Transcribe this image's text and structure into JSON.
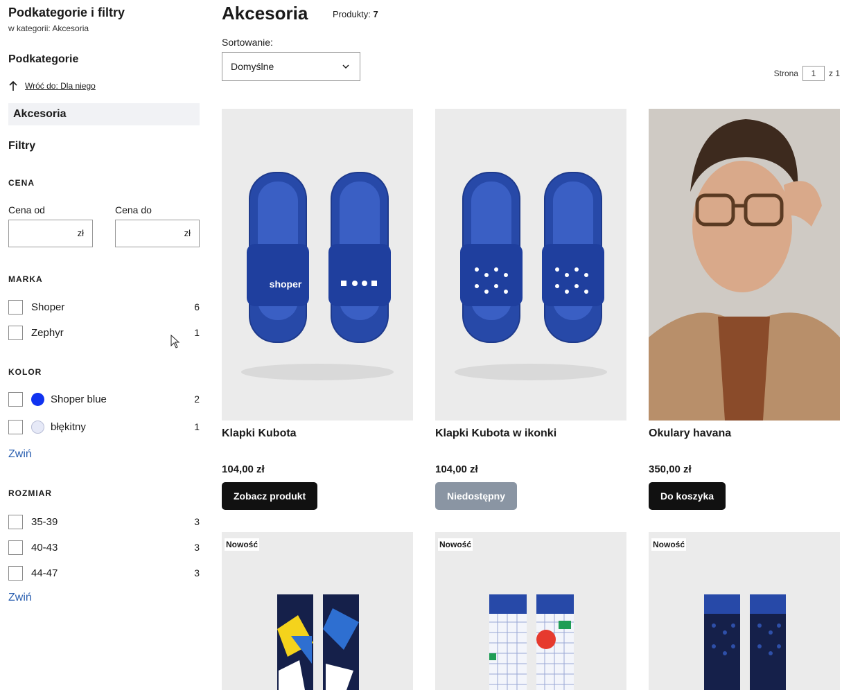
{
  "sidebar": {
    "title": "Podkategorie i filtry",
    "subtitle": "w kategorii: Akcesoria",
    "subcategories_heading": "Podkategorie",
    "back_link": "Wróć do: Dla niego",
    "active_category": "Akcesoria",
    "filters_heading": "Filtry",
    "price": {
      "heading": "CENA",
      "from_label": "Cena od",
      "to_label": "Cena do",
      "from_value": "",
      "to_value": "",
      "currency": "zł"
    },
    "brand": {
      "heading": "MARKA",
      "items": [
        {
          "label": "Shoper",
          "count": "6"
        },
        {
          "label": "Zephyr",
          "count": "1"
        }
      ]
    },
    "color": {
      "heading": "KOLOR",
      "items": [
        {
          "label": "Shoper blue",
          "count": "2",
          "swatch": "#1033f0"
        },
        {
          "label": "błękitny",
          "count": "1",
          "swatch": "#e6e9f7"
        }
      ],
      "collapse_label": "Zwiń"
    },
    "size": {
      "heading": "ROZMIAR",
      "items": [
        {
          "label": "35-39",
          "count": "3"
        },
        {
          "label": "40-43",
          "count": "3"
        },
        {
          "label": "44-47",
          "count": "3"
        }
      ],
      "collapse_label": "Zwiń"
    }
  },
  "main": {
    "title": "Akcesoria",
    "products_label": "Produkty:",
    "products_count": "7",
    "sort_label": "Sortowanie:",
    "sort_value": "Domyślne",
    "pager": {
      "label": "Strona",
      "current": "1",
      "of_label": "z 1"
    }
  },
  "products": [
    {
      "name": "Klapki Kubota",
      "price": "104,00 zł",
      "button": "Zobacz produkt",
      "available": true
    },
    {
      "name": "Klapki Kubota w ikonki",
      "price": "104,00 zł",
      "button": "Niedostępny",
      "available": false
    },
    {
      "name": "Okulary havana",
      "price": "350,00 zł",
      "button": "Do koszyka",
      "available": true
    },
    {
      "badge": "Nowość"
    },
    {
      "badge": "Nowość"
    },
    {
      "badge": "Nowość"
    }
  ],
  "colors": {
    "button_dark": "#111111",
    "button_disabled": "#8a95a3",
    "link_blue": "#2a5fb0",
    "active_category_bg": "#f1f2f5",
    "slipper_blue": "#2749a8"
  }
}
